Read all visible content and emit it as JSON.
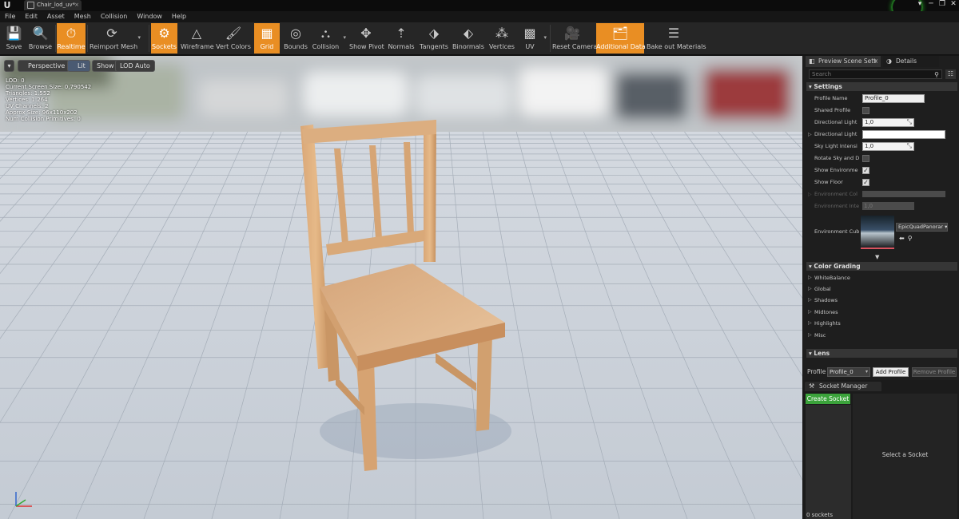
{
  "window": {
    "tab_title": "Chair_lod_uv*",
    "tab_close": "×",
    "logo": "U",
    "controls": [
      "▾",
      "─",
      "❐",
      "✕"
    ]
  },
  "menu": [
    "File",
    "Edit",
    "Asset",
    "Mesh",
    "Collision",
    "Window",
    "Help"
  ],
  "toolbar": [
    {
      "label": "Save",
      "icon": "save-icon",
      "active": false
    },
    {
      "label": "Browse",
      "icon": "browse-icon",
      "active": false
    },
    {
      "label": "Realtime",
      "icon": "realtime-icon",
      "active": true
    },
    {
      "label": "Reimport Mesh",
      "icon": "reimport-icon",
      "active": false
    },
    {
      "label": "Sockets",
      "icon": "sockets-icon",
      "active": true
    },
    {
      "label": "Wireframe",
      "icon": "wireframe-icon",
      "active": false
    },
    {
      "label": "Vert Colors",
      "icon": "vert-colors-icon",
      "active": false
    },
    {
      "label": "Grid",
      "icon": "grid-icon",
      "active": true
    },
    {
      "label": "Bounds",
      "icon": "bounds-icon",
      "active": false
    },
    {
      "label": "Collision",
      "icon": "collision-icon",
      "active": false
    },
    {
      "label": "Show Pivot",
      "icon": "pivot-icon",
      "active": false
    },
    {
      "label": "Normals",
      "icon": "normals-icon",
      "active": false
    },
    {
      "label": "Tangents",
      "icon": "tangents-icon",
      "active": false
    },
    {
      "label": "Binormals",
      "icon": "binormals-icon",
      "active": false
    },
    {
      "label": "Vertices",
      "icon": "vertices-icon",
      "active": false
    },
    {
      "label": "UV",
      "icon": "uv-icon",
      "active": false
    },
    {
      "label": "Reset Camera",
      "icon": "reset-camera-icon",
      "active": false
    },
    {
      "label": "Additional Data",
      "icon": "additional-data-icon",
      "active": true
    },
    {
      "label": "Bake out Materials",
      "icon": "bake-icon",
      "active": false
    }
  ],
  "viewport": {
    "buttons": {
      "menu": "▾",
      "perspective": "Perspective",
      "lit": "Lit",
      "show": "Show",
      "lod": "LOD Auto"
    },
    "stats": [
      {
        "label": "LOD:",
        "value": "0"
      },
      {
        "label": "Current Screen Size:",
        "value": "0,790542"
      },
      {
        "label": "Triangles:",
        "value": "1.552"
      },
      {
        "label": "Vertices:",
        "value": "1.264"
      },
      {
        "label": "UV Channels:",
        "value": "2"
      },
      {
        "label": "Approx Size:",
        "value": "96x110x202"
      },
      {
        "label": "Num Collision Primitives:",
        "value": "0"
      }
    ]
  },
  "panel": {
    "tabs": [
      {
        "label": "Preview Scene Sett",
        "close": "×"
      },
      {
        "label": "Details",
        "close": ""
      }
    ],
    "search_placeholder": "Search",
    "settings": {
      "title": "Settings",
      "profile_name_label": "Profile Name",
      "profile_name_value": "Profile_0",
      "shared_profile_label": "Shared Profile",
      "dir_light_intensity_label": "Directional Light",
      "dir_light_intensity_value": "1,0",
      "dir_light_color_label": "Directional Light",
      "dir_light_color": "#ffffff",
      "sky_light_label": "Sky Light Intensi",
      "sky_light_value": "1,0",
      "rotate_sky_label": "Rotate Sky and D",
      "show_env_label": "Show Environme",
      "show_floor_label": "Show Floor",
      "env_color_label": "Environment Col",
      "env_intensity_label": "Environment Inte",
      "env_intensity_value": "1,0",
      "env_cube_label": "Environment Cub",
      "env_cube_value": "EpicQuadPanorar"
    },
    "color_grading": {
      "title": "Color Grading",
      "items": [
        "WhiteBalance",
        "Global",
        "Shadows",
        "Midtones",
        "Highlights",
        "Misc"
      ]
    },
    "lens": {
      "title": "Lens"
    },
    "profile": {
      "label": "Profile",
      "value": "Profile_0",
      "add": "Add Profile",
      "remove": "Remove Profile"
    },
    "socket_manager": {
      "title": "Socket Manager",
      "create": "Create Socket",
      "count": "0 sockets",
      "select_hint": "Select a Socket"
    }
  }
}
